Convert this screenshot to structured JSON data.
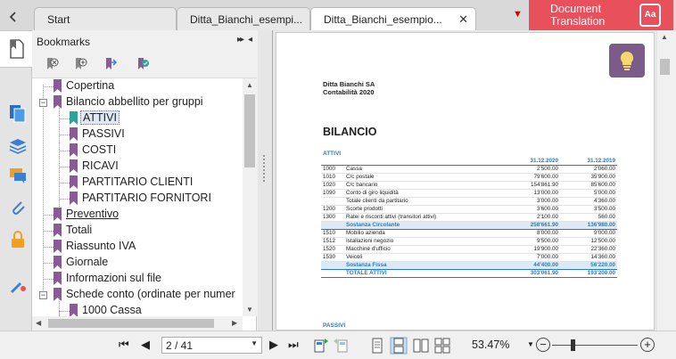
{
  "tabs": [
    {
      "label": "Start"
    },
    {
      "label": "Ditta_Bianchi_esempi..."
    },
    {
      "label": "Ditta_Bianchi_esempio..."
    }
  ],
  "tab_close": "✕",
  "tab_dropdown": "▼",
  "doc_translation": {
    "line1": "Document",
    "line2": "Translation",
    "icon": "Aa"
  },
  "bookmarks": {
    "title": "Bookmarks",
    "collapse": "▸▸",
    "pin": "◂",
    "items": [
      {
        "label": "Copertina"
      },
      {
        "label": "Bilancio abbellito per gruppi"
      },
      {
        "label": "ATTIVI"
      },
      {
        "label": "PASSIVI"
      },
      {
        "label": "COSTI"
      },
      {
        "label": "RICAVI"
      },
      {
        "label": "PARTITARIO CLIENTI"
      },
      {
        "label": "PARTITARIO FORNITORI"
      },
      {
        "label": "Preventivo"
      },
      {
        "label": "Totali"
      },
      {
        "label": "Riassunto IVA"
      },
      {
        "label": "Giornale"
      },
      {
        "label": "Informazioni sul file"
      },
      {
        "label": "Schede conto (ordinate per numer"
      },
      {
        "label": "1000 Cassa"
      }
    ],
    "expand_minus": "−",
    "expand_plus": "+"
  },
  "document": {
    "company": "Ditta Bianchi SA",
    "subtitle": "Contabilità 2020",
    "heading": "BILANCIO",
    "section1": "ATTIVI",
    "col_date1": "31.12.2020",
    "col_date2": "31.12.2019",
    "rows": [
      {
        "code": "1000",
        "desc": "Cassa",
        "v1": "2'500.00",
        "v2": "2'060.00",
        "type": "row"
      },
      {
        "code": "1010",
        "desc": "C/c postale",
        "v1": "79'600.00",
        "v2": "35'900.00",
        "type": "row"
      },
      {
        "code": "1020",
        "desc": "C/c bancario",
        "v1": "154'861.90",
        "v2": "85'600.00",
        "type": "row"
      },
      {
        "code": "1090",
        "desc": "Conto di giro liquidità",
        "v1": "13'000.00",
        "v2": "5'000.00",
        "type": "row"
      },
      {
        "code": "",
        "desc": "Totale clienti da partitario",
        "v1": "3'000.00",
        "v2": "4'360.00",
        "type": "row"
      },
      {
        "code": "1200",
        "desc": "Scorte prodotti",
        "v1": "3'600.00",
        "v2": "3'500.00",
        "type": "row"
      },
      {
        "code": "1300",
        "desc": "Ratei e risconti attivi (transitori attivi)",
        "v1": "2'100.00",
        "v2": "560.00",
        "type": "row"
      },
      {
        "code": "",
        "desc": "Sostanza Circolante",
        "v1": "258'661.90",
        "v2": "136'980.00",
        "type": "sub"
      },
      {
        "code": "1510",
        "desc": "Mobilio azienda",
        "v1": "8'000.00",
        "v2": "9'000.00",
        "type": "row"
      },
      {
        "code": "1512",
        "desc": "Istallazioni negozio",
        "v1": "9'500.00",
        "v2": "12'500.00",
        "type": "row"
      },
      {
        "code": "1520",
        "desc": "Macchine d'ufficio",
        "v1": "19'900.00",
        "v2": "22'360.00",
        "type": "row"
      },
      {
        "code": "1530",
        "desc": "Veicoli",
        "v1": "7'000.00",
        "v2": "14'360.00",
        "type": "row"
      },
      {
        "code": "",
        "desc": "Sostanza Fissa",
        "v1": "44'400.00",
        "v2": "56'220.00",
        "type": "sub"
      },
      {
        "code": "",
        "desc": "TOTALE ATTIVI",
        "v1": "303'061.90",
        "v2": "193'200.00",
        "type": "tot"
      }
    ],
    "section2": "PASSIVI",
    "section2_dates": "31.12.2020   31.12.2019"
  },
  "statusbar": {
    "first": "⏮",
    "prev": "◀",
    "page_value": "2 / 41",
    "page_drop": "▼",
    "next": "▶",
    "last": "⏭",
    "zoom": "53.47%",
    "zoom_drop": "▼",
    "zoom_minus": "−",
    "zoom_plus": "+",
    "zoom_level": 0.24
  },
  "colors": {
    "accent": "#7b5b89",
    "bookmark_purple": "#8a5a96",
    "bookmark_teal": "#2ea39a",
    "translation_red": "#e8505b",
    "doc_blue": "#2b7bb9"
  },
  "icons": [
    "bookmarks-icon",
    "pages-icon",
    "layers-icon",
    "comments-icon",
    "attachments-icon",
    "security-icon",
    "signature-icon",
    "lightbulb-icon"
  ]
}
